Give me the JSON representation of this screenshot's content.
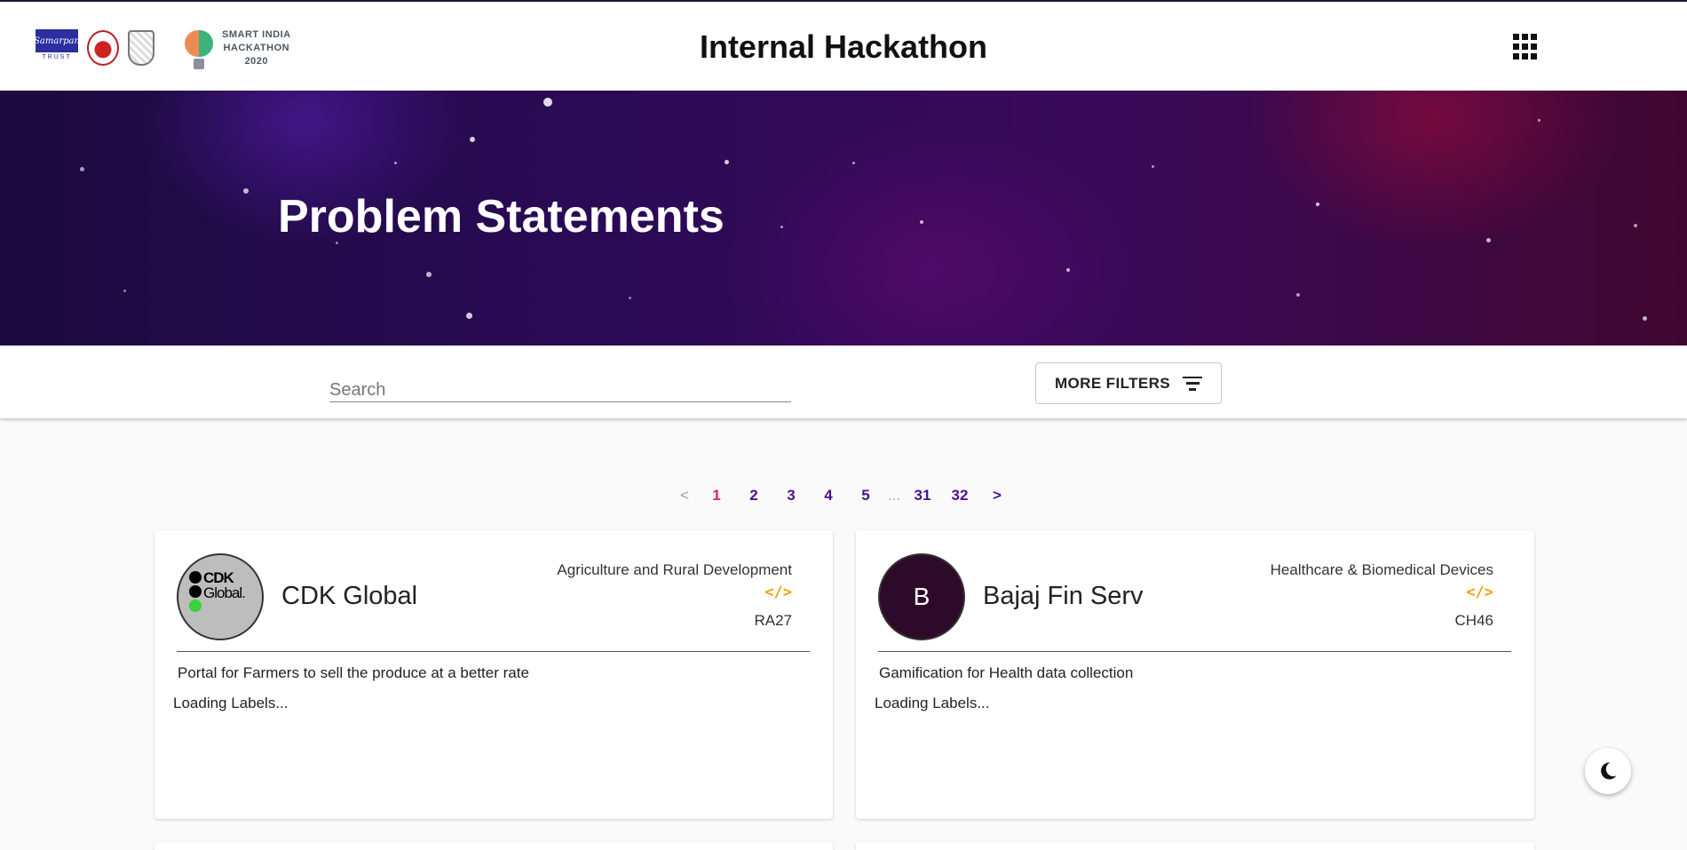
{
  "header": {
    "title": "Internal Hackathon",
    "logos": {
      "trust_logo_text": "Samarpan",
      "trust_caption": "TRUST",
      "sih_line1": "SMART INDIA",
      "sih_line2": "HACKATHON",
      "sih_year": "2020"
    },
    "menu_icon": "apps-grid-icon"
  },
  "hero": {
    "title": "Problem Statements"
  },
  "filters": {
    "search_placeholder": "Search",
    "more_filters_label": "MORE FILTERS",
    "filter_icon": "filter-list-icon"
  },
  "pagination": {
    "prev": "<",
    "next": ">",
    "pages": [
      "1",
      "2",
      "3",
      "4",
      "5"
    ],
    "ellipsis": "...",
    "last_pages": [
      "31",
      "32"
    ],
    "current": "1"
  },
  "cards": [
    {
      "company": "CDK Global",
      "logo_text_line1": "CDK",
      "logo_text_line2": "Global.",
      "domain": "Agriculture and Rural Development",
      "code_icon": "</>",
      "code": "RA27",
      "description": "Portal for Farmers to sell the produce at a better rate",
      "labels_status": "Loading Labels..."
    },
    {
      "company": "Bajaj Fin Serv",
      "avatar_letter": "B",
      "domain": "Healthcare & Biomedical Devices",
      "code_icon": "</>",
      "code": "CH46",
      "description": "Gamification for Health data collection",
      "labels_status": "Loading Labels..."
    }
  ],
  "theme_toggle": {
    "icon": "moon-icon"
  },
  "colors": {
    "accent": "#4a148c",
    "active_page": "#e91e63",
    "code_icon": "#f5a000",
    "hero_dark": "#1b0b3f"
  }
}
